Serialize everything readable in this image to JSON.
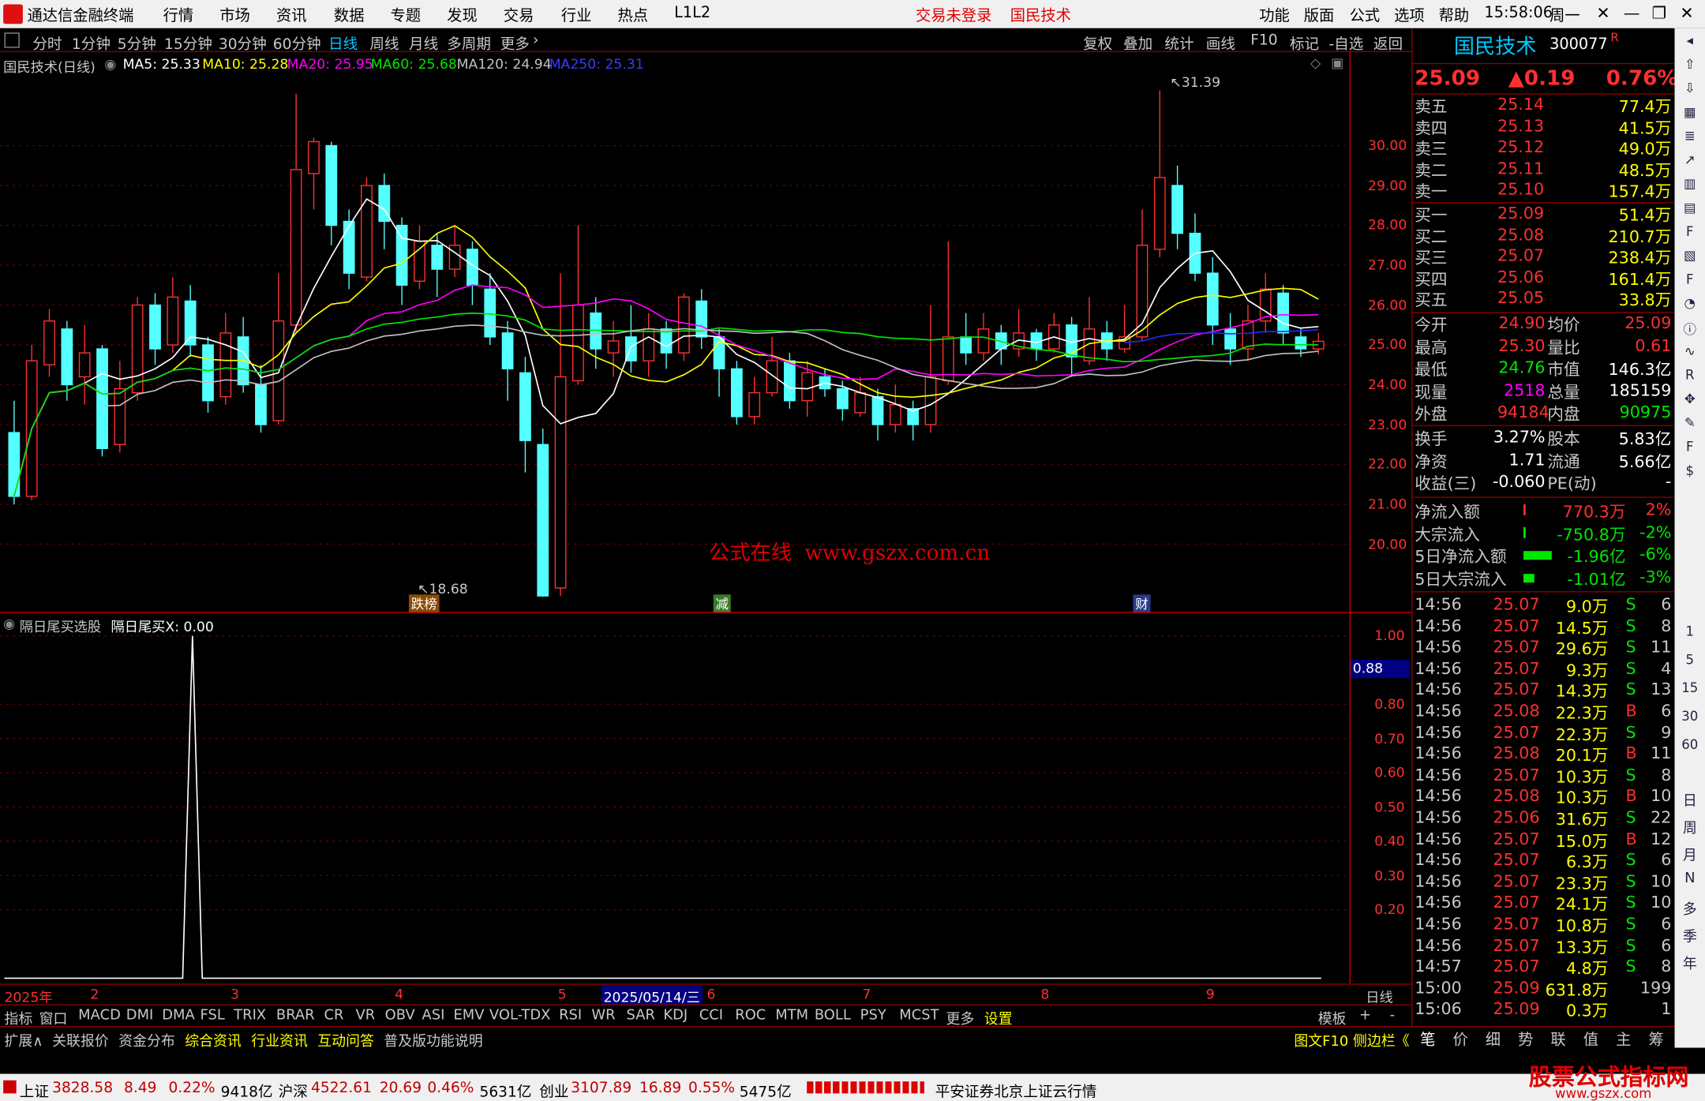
{
  "app": {
    "title": "通达信金融终端",
    "menu": [
      "行情",
      "市场",
      "资讯",
      "数据",
      "专题",
      "发现",
      "交易",
      "行业",
      "热点",
      "L1L2"
    ],
    "login": "交易未登录",
    "stock_tag": "国民技术",
    "right_menu": [
      "功能",
      "版面",
      "公式",
      "选项",
      "帮助"
    ],
    "time": "15:58:06",
    "weekday": "周一"
  },
  "periods": [
    "分时",
    "1分钟",
    "5分钟",
    "15分钟",
    "30分钟",
    "60分钟",
    "日线",
    "周线",
    "月线",
    "多周期",
    "更多"
  ],
  "period_active": "日线",
  "right_tools": [
    "复权",
    "叠加",
    "统计",
    "画线",
    "F10",
    "标记",
    "-自选",
    "返回"
  ],
  "legend": {
    "name": "国民技术(日线)",
    "ma5": "MA5: 25.33",
    "ma10": "MA10: 25.28",
    "ma20": "MA20: 25.95",
    "ma60": "MA60: 25.68",
    "ma120": "MA120: 24.94",
    "ma250": "MA250: 25.31"
  },
  "watermark": "公式在线  www.gszx.com.cn",
  "annotations": {
    "high": "31.39",
    "low": "18.68",
    "tag1": "跌榜",
    "tag2": "减",
    "tag3": "财"
  },
  "y_axis": [
    "30.00",
    "29.00",
    "28.00",
    "27.00",
    "26.00",
    "25.00",
    "24.00",
    "23.00",
    "22.00",
    "21.00",
    "20.00"
  ],
  "sub": {
    "name": "隔日尾买选股",
    "value": "隔日尾买X: 0.00",
    "axis": [
      "1.00",
      "0.80",
      "0.70",
      "0.60",
      "0.50",
      "0.40",
      "0.30",
      "0.20"
    ],
    "cursor": "0.88"
  },
  "dates": [
    "2025年",
    "2",
    "3",
    "4",
    "5",
    "2025/05/14/三",
    "6",
    "7",
    "8",
    "9",
    "日线"
  ],
  "indicators": [
    "指标",
    "窗口",
    "MACD",
    "DMI",
    "DMA",
    "FSL",
    "TRIX",
    "BRAR",
    "CR",
    "VR",
    "OBV",
    "ASI",
    "EMV",
    "VOL-TDX",
    "RSI",
    "WR",
    "SAR",
    "KDJ",
    "CCI",
    "ROC",
    "MTM",
    "BOLL",
    "PSY",
    "MCST",
    "更多",
    "设置",
    "模板",
    "+",
    "-"
  ],
  "ext": [
    "扩展∧",
    "关联报价",
    "资金分布",
    "综合资讯",
    "行业资讯",
    "互动问答",
    "普及版功能说明"
  ],
  "ext_right": "图文F10 侧边栏《",
  "quote": {
    "name": "国民技术",
    "code": "300077",
    "flag": "R",
    "price": "25.09",
    "change": "▲0.19",
    "pct": "0.76%",
    "asks": [
      [
        "卖五",
        "25.14",
        "77.4万"
      ],
      [
        "卖四",
        "25.13",
        "41.5万"
      ],
      [
        "卖三",
        "25.12",
        "49.0万"
      ],
      [
        "卖二",
        "25.11",
        "48.5万"
      ],
      [
        "卖一",
        "25.10",
        "157.4万"
      ]
    ],
    "bids": [
      [
        "买一",
        "25.09",
        "51.4万"
      ],
      [
        "买二",
        "25.08",
        "210.7万"
      ],
      [
        "买三",
        "25.07",
        "238.4万"
      ],
      [
        "买四",
        "25.06",
        "161.4万"
      ],
      [
        "买五",
        "25.05",
        "33.8万"
      ]
    ],
    "stats": [
      [
        "今开",
        "24.90",
        "均价",
        "25.09"
      ],
      [
        "最高",
        "25.30",
        "量比",
        "0.61"
      ],
      [
        "最低",
        "24.76",
        "市值",
        "146.3亿"
      ],
      [
        "现量",
        "2518",
        "总量",
        "185159"
      ],
      [
        "外盘",
        "94184",
        "内盘",
        "90975"
      ]
    ],
    "stats2": [
      [
        "换手",
        "3.27%",
        "股本",
        "5.83亿"
      ],
      [
        "净资",
        "1.71",
        "流通",
        "5.66亿"
      ],
      [
        "收益(三)",
        "-0.060",
        "PE(动)",
        "-"
      ]
    ],
    "flows": [
      [
        "净流入额",
        "770.3万",
        "2%"
      ],
      [
        "大宗流入",
        "-750.8万",
        "-2%"
      ],
      [
        "5日净流入额",
        "-1.96亿",
        "-6%"
      ],
      [
        "5日大宗流入",
        "-1.01亿",
        "-3%"
      ]
    ],
    "ticks": [
      [
        "14:56",
        "25.07",
        "9.0万",
        "S",
        "6"
      ],
      [
        "14:56",
        "25.07",
        "14.5万",
        "S",
        "8"
      ],
      [
        "14:56",
        "25.07",
        "29.6万",
        "S",
        "11"
      ],
      [
        "14:56",
        "25.07",
        "9.3万",
        "S",
        "4"
      ],
      [
        "14:56",
        "25.07",
        "14.3万",
        "S",
        "13"
      ],
      [
        "14:56",
        "25.08",
        "22.3万",
        "B",
        "6"
      ],
      [
        "14:56",
        "25.07",
        "22.3万",
        "S",
        "9"
      ],
      [
        "14:56",
        "25.08",
        "20.1万",
        "B",
        "11"
      ],
      [
        "14:56",
        "25.07",
        "10.3万",
        "S",
        "8"
      ],
      [
        "14:56",
        "25.08",
        "10.3万",
        "B",
        "10"
      ],
      [
        "14:56",
        "25.06",
        "31.6万",
        "S",
        "22"
      ],
      [
        "14:56",
        "25.07",
        "15.0万",
        "B",
        "12"
      ],
      [
        "14:56",
        "25.07",
        "6.3万",
        "S",
        "6"
      ],
      [
        "14:56",
        "25.07",
        "23.3万",
        "S",
        "10"
      ],
      [
        "14:56",
        "25.07",
        "24.1万",
        "S",
        "10"
      ],
      [
        "14:56",
        "25.07",
        "10.8万",
        "S",
        "6"
      ],
      [
        "14:56",
        "25.07",
        "13.3万",
        "S",
        "6"
      ],
      [
        "14:57",
        "25.07",
        "4.8万",
        "S",
        "8"
      ],
      [
        "15:00",
        "25.09",
        "631.8万",
        "",
        "199"
      ],
      [
        "15:06",
        "25.09",
        "0.3万",
        "",
        "1"
      ]
    ]
  },
  "rtabs": [
    "笔",
    "价",
    "细",
    "势",
    "联",
    "值",
    "主",
    "筹"
  ],
  "side_tools": [
    "日",
    "周",
    "月",
    "N",
    "多",
    "季",
    "年"
  ],
  "status": {
    "sh_name": "上证",
    "sh_val": "3828.58",
    "sh_chg": "8.49",
    "sh_pct": "0.22%",
    "sh_amt": "9418亿",
    "sz_name": "沪深",
    "sz_val": "4522.61",
    "sz_chg": "20.69",
    "sz_pct": "0.46%",
    "sz_amt": "5631亿",
    "cy_name": "创业",
    "cy_val": "3107.89",
    "cy_chg": "16.89",
    "cy_pct": "0.55%",
    "cy_amt": "5475亿",
    "broker": "平安证券北京上证云行情",
    "brand": "股票公式指标网",
    "brand_url": "www.gszx.com"
  },
  "colors": {
    "up": "#ff3232",
    "down": "#54ffff",
    "ma5": "#ffffff",
    "ma10": "#ffff00",
    "ma20": "#ff00ff",
    "ma60": "#00e600",
    "ma120": "#c0c0c0",
    "ma250": "#2828ff"
  },
  "chart_data": {
    "type": "candlestick",
    "ylim": [
      18.3,
      31.8
    ],
    "candles": [
      [
        22.8,
        21.2,
        23.6,
        21.0
      ],
      [
        21.2,
        24.6,
        25.0,
        21.1
      ],
      [
        24.5,
        25.6,
        25.9,
        24.2
      ],
      [
        25.4,
        24.0,
        25.6,
        23.6
      ],
      [
        24.2,
        24.8,
        25.5,
        23.5
      ],
      [
        24.9,
        22.4,
        25.0,
        22.2
      ],
      [
        22.5,
        23.9,
        24.6,
        22.3
      ],
      [
        23.8,
        26.0,
        26.2,
        23.6
      ],
      [
        26.0,
        24.9,
        26.3,
        24.5
      ],
      [
        25.0,
        26.2,
        26.7,
        24.8
      ],
      [
        26.1,
        25.0,
        26.5,
        24.7
      ],
      [
        25.0,
        23.6,
        25.2,
        23.3
      ],
      [
        23.7,
        25.3,
        25.8,
        23.5
      ],
      [
        25.2,
        24.0,
        25.7,
        23.8
      ],
      [
        24.0,
        23.0,
        24.5,
        22.8
      ],
      [
        23.1,
        25.6,
        26.8,
        23.0
      ],
      [
        25.5,
        29.4,
        31.3,
        25.3
      ],
      [
        29.3,
        30.1,
        30.2,
        28.4
      ],
      [
        30.0,
        28.0,
        30.1,
        27.5
      ],
      [
        28.1,
        26.8,
        28.4,
        26.4
      ],
      [
        26.7,
        29.0,
        29.2,
        26.6
      ],
      [
        29.0,
        28.1,
        29.3,
        27.4
      ],
      [
        28.0,
        26.5,
        28.2,
        26.0
      ],
      [
        26.6,
        27.6,
        28.0,
        26.4
      ],
      [
        27.5,
        26.9,
        27.8,
        26.2
      ],
      [
        26.9,
        27.5,
        28.0,
        26.7
      ],
      [
        27.4,
        26.5,
        27.6,
        26.0
      ],
      [
        26.4,
        25.2,
        26.8,
        25.0
      ],
      [
        25.3,
        24.4,
        25.6,
        23.6
      ],
      [
        24.3,
        22.6,
        24.7,
        21.8
      ],
      [
        22.5,
        18.7,
        22.9,
        18.68
      ],
      [
        18.9,
        24.2,
        26.8,
        18.7
      ],
      [
        24.1,
        26.0,
        28.0,
        24.0
      ],
      [
        25.8,
        24.9,
        26.2,
        24.4
      ],
      [
        24.8,
        25.1,
        25.6,
        24.2
      ],
      [
        25.2,
        24.6,
        26.0,
        24.3
      ],
      [
        24.6,
        25.4,
        25.8,
        24.2
      ],
      [
        25.4,
        24.8,
        25.6,
        24.4
      ],
      [
        24.8,
        26.2,
        26.3,
        24.6
      ],
      [
        26.1,
        25.2,
        26.4,
        24.9
      ],
      [
        25.2,
        24.4,
        25.4,
        23.7
      ],
      [
        24.4,
        23.2,
        24.6,
        23.0
      ],
      [
        23.2,
        23.8,
        24.2,
        23.0
      ],
      [
        23.8,
        24.6,
        25.2,
        23.7
      ],
      [
        24.6,
        23.6,
        24.8,
        23.4
      ],
      [
        23.6,
        24.3,
        24.6,
        23.2
      ],
      [
        24.2,
        23.9,
        24.4,
        23.7
      ],
      [
        23.9,
        23.4,
        24.1,
        23.1
      ],
      [
        23.3,
        23.8,
        24.2,
        23.2
      ],
      [
        23.7,
        23.0,
        23.9,
        22.6
      ],
      [
        23.0,
        23.5,
        24.0,
        22.8
      ],
      [
        23.4,
        23.0,
        23.6,
        22.6
      ],
      [
        23.0,
        24.2,
        26.0,
        22.8
      ],
      [
        24.1,
        25.2,
        27.6,
        24.0
      ],
      [
        25.2,
        24.8,
        25.8,
        24.5
      ],
      [
        24.8,
        25.4,
        25.8,
        24.6
      ],
      [
        25.3,
        24.9,
        25.5,
        24.5
      ],
      [
        24.9,
        25.3,
        25.9,
        24.7
      ],
      [
        25.3,
        24.9,
        25.4,
        24.6
      ],
      [
        24.9,
        25.5,
        25.8,
        24.8
      ],
      [
        25.5,
        24.7,
        25.7,
        24.2
      ],
      [
        24.6,
        25.4,
        26.2,
        24.5
      ],
      [
        25.3,
        24.9,
        25.6,
        24.6
      ],
      [
        24.9,
        25.2,
        26.0,
        24.8
      ],
      [
        25.2,
        27.5,
        28.4,
        25.1
      ],
      [
        27.4,
        29.2,
        31.39,
        27.2
      ],
      [
        29.0,
        27.8,
        29.5,
        27.4
      ],
      [
        27.8,
        26.8,
        28.3,
        26.6
      ],
      [
        26.8,
        25.5,
        27.2,
        25.0
      ],
      [
        25.4,
        24.9,
        25.8,
        24.5
      ],
      [
        24.9,
        25.6,
        26.0,
        24.6
      ],
      [
        25.6,
        26.4,
        26.8,
        25.3
      ],
      [
        26.3,
        25.3,
        26.5,
        25.0
      ],
      [
        25.2,
        24.9,
        25.4,
        24.7
      ],
      [
        24.9,
        25.09,
        25.3,
        24.76
      ]
    ]
  }
}
